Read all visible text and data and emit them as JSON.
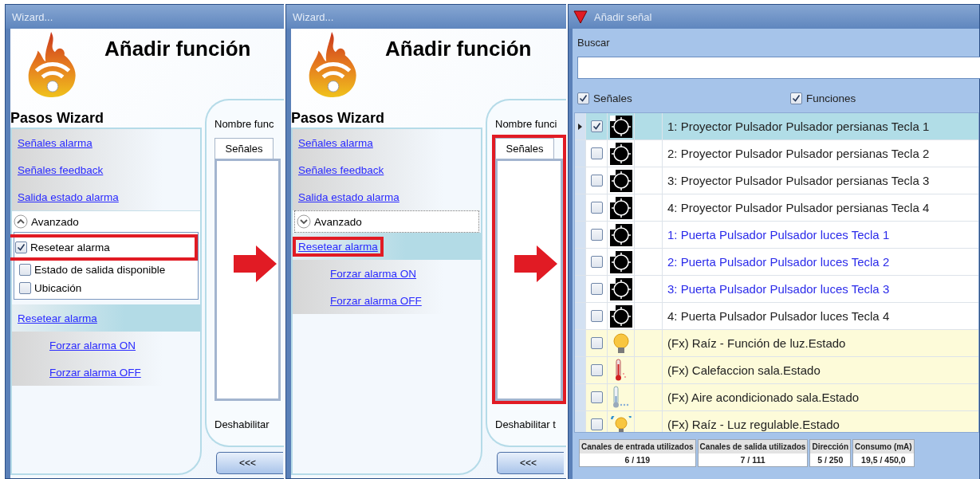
{
  "wizards": [
    {
      "title": "Wizard...",
      "heading": "Añadir función",
      "steps_heading": "Pasos Wizard",
      "arrow_after": true,
      "steps": [
        {
          "kind": "link",
          "label": "Señales alarma",
          "selected": false,
          "highlighted": false
        },
        {
          "kind": "link",
          "label": "Señales feedback",
          "selected": false,
          "highlighted": false
        },
        {
          "kind": "link",
          "label": "Salida estado alarma",
          "selected": false,
          "highlighted": false
        },
        {
          "kind": "expander",
          "label": "Avanzado",
          "expanded": true,
          "options": [
            {
              "label": "Resetear alarma",
              "checked": true,
              "highlighted": true
            },
            {
              "label": "Estado de salida disponible",
              "checked": false,
              "highlighted": false
            },
            {
              "label": "Ubicación",
              "checked": false,
              "highlighted": false
            }
          ]
        },
        {
          "kind": "link",
          "label": "Resetear alarma",
          "selected": true,
          "highlighted": false
        },
        {
          "kind": "sublink",
          "label": "Forzar alarma ON",
          "selected": false,
          "highlighted": false
        },
        {
          "kind": "sublink",
          "label": "Forzar alarma OFF",
          "selected": false,
          "highlighted": false
        }
      ],
      "field_label": "Nombre func",
      "tab": {
        "label": "Señales",
        "selected": true
      },
      "tab_highlighted": false,
      "footer_label": "Deshabilitar",
      "back_button": "<<<"
    },
    {
      "title": "Wizard...",
      "heading": "Añadir función",
      "steps_heading": "Pasos Wizard",
      "arrow_after": true,
      "steps": [
        {
          "kind": "link",
          "label": "Señales alarma",
          "selected": false,
          "highlighted": false
        },
        {
          "kind": "link",
          "label": "Señales feedback",
          "selected": false,
          "highlighted": false
        },
        {
          "kind": "link",
          "label": "Salida estado alarma",
          "selected": false,
          "highlighted": false
        },
        {
          "kind": "expander",
          "label": "Avanzado",
          "expanded": false
        },
        {
          "kind": "link",
          "label": "Resetear alarma",
          "selected": true,
          "highlighted": true
        },
        {
          "kind": "sublink",
          "label": "Forzar alarma ON",
          "selected": false,
          "highlighted": false
        },
        {
          "kind": "sublink",
          "label": "Forzar alarma OFF",
          "selected": false,
          "highlighted": false
        }
      ],
      "field_label": "Nombre funci",
      "tab": {
        "label": "Señales",
        "selected": true
      },
      "tab_highlighted": true,
      "footer_label": "Deshabilitar t",
      "back_button": "<<<"
    }
  ],
  "signal_dialog": {
    "title": "Añadir señal",
    "search_label": "Buscar",
    "filters": [
      {
        "label": "Señales",
        "checked": true
      },
      {
        "label": "Funciones",
        "checked": true
      }
    ],
    "rows": [
      {
        "kind": "signal",
        "label": "1: Proyector Pulsador Pulsador persianas Tecla 1",
        "checked": true,
        "selected": true,
        "color": "#222222"
      },
      {
        "kind": "signal",
        "label": "2: Proyector Pulsador Pulsador persianas Tecla 2",
        "checked": false,
        "selected": false,
        "color": "#222222"
      },
      {
        "kind": "signal",
        "label": "3: Proyector Pulsador Pulsador persianas Tecla 3",
        "checked": false,
        "selected": false,
        "color": "#222222"
      },
      {
        "kind": "signal",
        "label": "4: Proyector Pulsador Pulsador persianas Tecla 4",
        "checked": false,
        "selected": false,
        "color": "#222222"
      },
      {
        "kind": "signal",
        "label": "1: Puerta Pulsador Pulsador luces Tecla 1",
        "checked": false,
        "selected": false,
        "color": "#2b2bea"
      },
      {
        "kind": "signal",
        "label": "2: Puerta Pulsador Pulsador luces Tecla 2",
        "checked": false,
        "selected": false,
        "color": "#2b2bea"
      },
      {
        "kind": "signal",
        "label": "3: Puerta Pulsador Pulsador luces Tecla 3",
        "checked": false,
        "selected": false,
        "color": "#2b2bea"
      },
      {
        "kind": "signal",
        "label": "4: Puerta Pulsador Pulsador luces Tecla 4",
        "checked": false,
        "selected": false,
        "color": "#222222"
      },
      {
        "kind": "function",
        "label": "(Fx) Raíz - Función de luz.Estado",
        "checked": false,
        "selected": false,
        "color": "#222222"
      },
      {
        "kind": "function",
        "label": "(Fx) Calefaccion sala.Estado",
        "checked": false,
        "selected": false,
        "color": "#222222"
      },
      {
        "kind": "function",
        "label": "(Fx) Aire acondicionado sala.Estado",
        "checked": false,
        "selected": false,
        "color": "#222222"
      },
      {
        "kind": "function",
        "label": "(Fx) Raíz - Luz regulable.Estado",
        "checked": false,
        "selected": false,
        "color": "#222222"
      }
    ],
    "usage": [
      {
        "header": "Canales de entrada utilizados",
        "value": "6 / 119"
      },
      {
        "header": "Canales de salida utilizados",
        "value": "7 / 111"
      },
      {
        "header": "Dirección",
        "value": "5 / 250"
      },
      {
        "header": "Consumo (mA)",
        "value": "19,5 / 450,0"
      }
    ]
  }
}
